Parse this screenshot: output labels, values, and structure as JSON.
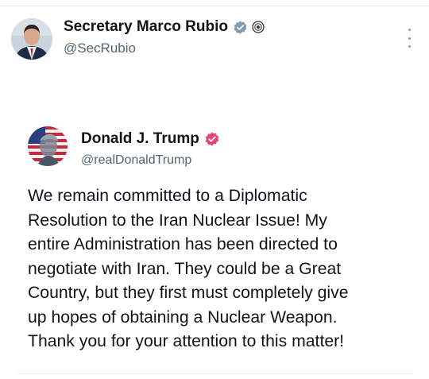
{
  "post": {
    "author_name": "Secretary Marco Rubio",
    "author_handle": "@SecRubio",
    "badge_icon": "verified-badge-icon",
    "affiliate_icon": "government-seal-icon",
    "menu_icon": "more-options-icon"
  },
  "quoted_post": {
    "author_name": "Donald J. Trump",
    "author_handle": "@realDonaldTrump",
    "badge_icon": "verified-badge-icon",
    "badge_color": "#e0245e",
    "text": "We remain committed to a Diplomatic\nResolution to the Iran Nuclear Issue! My\nentire Administration has been directed to\nnegotiate with Iran. They could be a Great\nCountry, but they first must completely give\nup hopes of obtaining a Nuclear Weapon.\nThank you for your attention to this matter!"
  },
  "colors": {
    "text_primary": "#0f1419",
    "text_secondary": "#536471",
    "gray_badge": "#829aab"
  }
}
